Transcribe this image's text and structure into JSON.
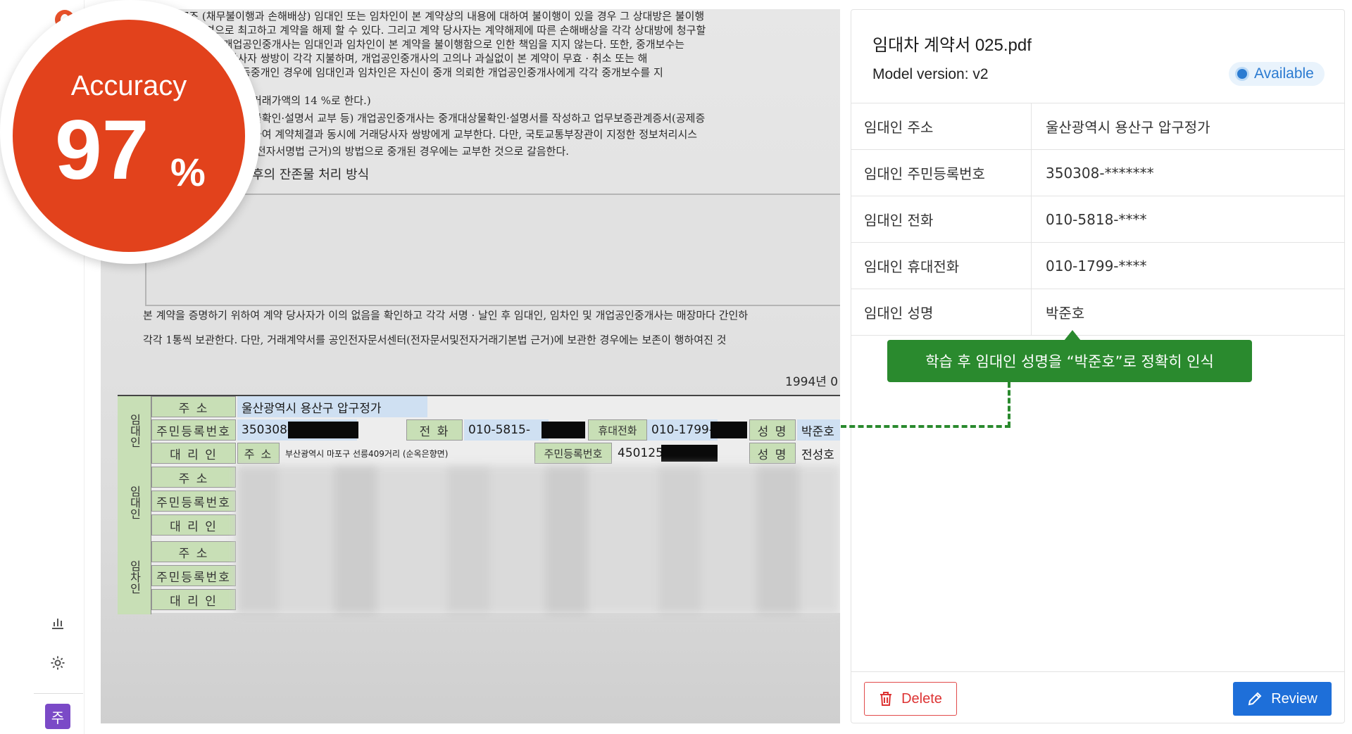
{
  "accuracy": {
    "label": "Accuracy",
    "value": "97",
    "unit": "%"
  },
  "panel": {
    "title": "임대차 계약서 025.pdf",
    "model_version": "Model version: v2",
    "status": "Available",
    "fields": [
      {
        "key": "임대인 주소",
        "value": "울산광역시 용산구 압구정가"
      },
      {
        "key": "임대인 주민등록번호",
        "value": "350308-*******"
      },
      {
        "key": "임대인 전화",
        "value": "010-5818-****"
      },
      {
        "key": "임대인 휴대전화",
        "value": "010-1799-****"
      },
      {
        "key": "임대인 성명",
        "value": "박준호"
      }
    ],
    "tooltip": "학습 후 임대인 성명을 “박준호”로 정확히 인식",
    "delete_label": "Delete",
    "review_label": "Review"
  },
  "sidebar": {
    "avatar_letter": "주",
    "chart_icon": "bar-chart-icon",
    "settings_icon": "gear-icon"
  },
  "document": {
    "lines": [
      "제7조 (채무불이행과 손해배상) 임대인 또는 임차인이 본 계약상의 내용에 대하여 불이행이 있을 경우 그 상대방은 불이행",
      "하여 서면으로 최고하고 계약을 해제 할 수 있다. 그리고 계약 당사자는 계약해제에 따른 손해배상을 각각 상대방에 청구할",
      "(중개보수) 개업공인중개사는 임대인과 임차인이 본 계약을 불이행함으로 인한 책임을 지지 않는다. 또한, 중개보수는",
      "동시에 계약 당사자 쌍방이 각각 지불하며, 개업공인중개사의 고의나 과실없이 본 계약이 무효 · 취소 또는 해",
      "는 지급한다. 공동중개인 경우에 임대인과 임차인은 자신이 중개 의뢰한 개업공인중개사에게 각각 중개보수를 지",
      "거래가액의          14 %로 한다.)",
      "물확인·설명서 교부 등) 개업공인중개사는 중개대상물확인·설명서를 작성하고 업무보증관계증서(공제증",
      "하여 계약체결과 동시에 거래당사자 쌍방에게 교부한다. 다만, 국토교통부장관이 지정한 정보처리시스",
      "(전자서명법 근거)의 방법으로 중개된 경우에는 교부한 것으로 갈음한다.",
      "후의 잔존물 처리 방식"
    ],
    "closing_1": "본 계약을 증명하기 위하여 계약 당사자가 이의 없음을 확인하고 각각 서명 · 날인 후 임대인, 임차인 및 개업공인중개사는 매장마다 간인하",
    "closing_2": "각각 1통씩 보관한다. 다만, 거래계약서를 공인전자문서센터(전자문서및전자거래기본법 근거)에 보관한 경우에는 보존이 행하여진 것",
    "date": "1994년 0",
    "form": {
      "side_lessor": "임대인",
      "side_lessee_1": "임대인",
      "side_lessee_2": "임차인",
      "label_address": "주        소",
      "label_rrn": "주민등록번호",
      "label_agent": "대  리  인",
      "label_phone": "전  화",
      "label_mobile": "휴대전화",
      "label_name": "성  명",
      "address": "울산광역시 용산구 압구정가",
      "rrn": "350308-",
      "phone": "010-5815-",
      "mobile": "010-1799-",
      "name": "박준호",
      "agent_address_label": "주 소",
      "agent_address": "부산광역시 마포구 선릉409거리 (순옥은향면)",
      "agent_rrn_label": "주민등록번호",
      "agent_rrn": "450125-",
      "agent_name_label": "성  명",
      "agent_name": "전성호"
    }
  }
}
